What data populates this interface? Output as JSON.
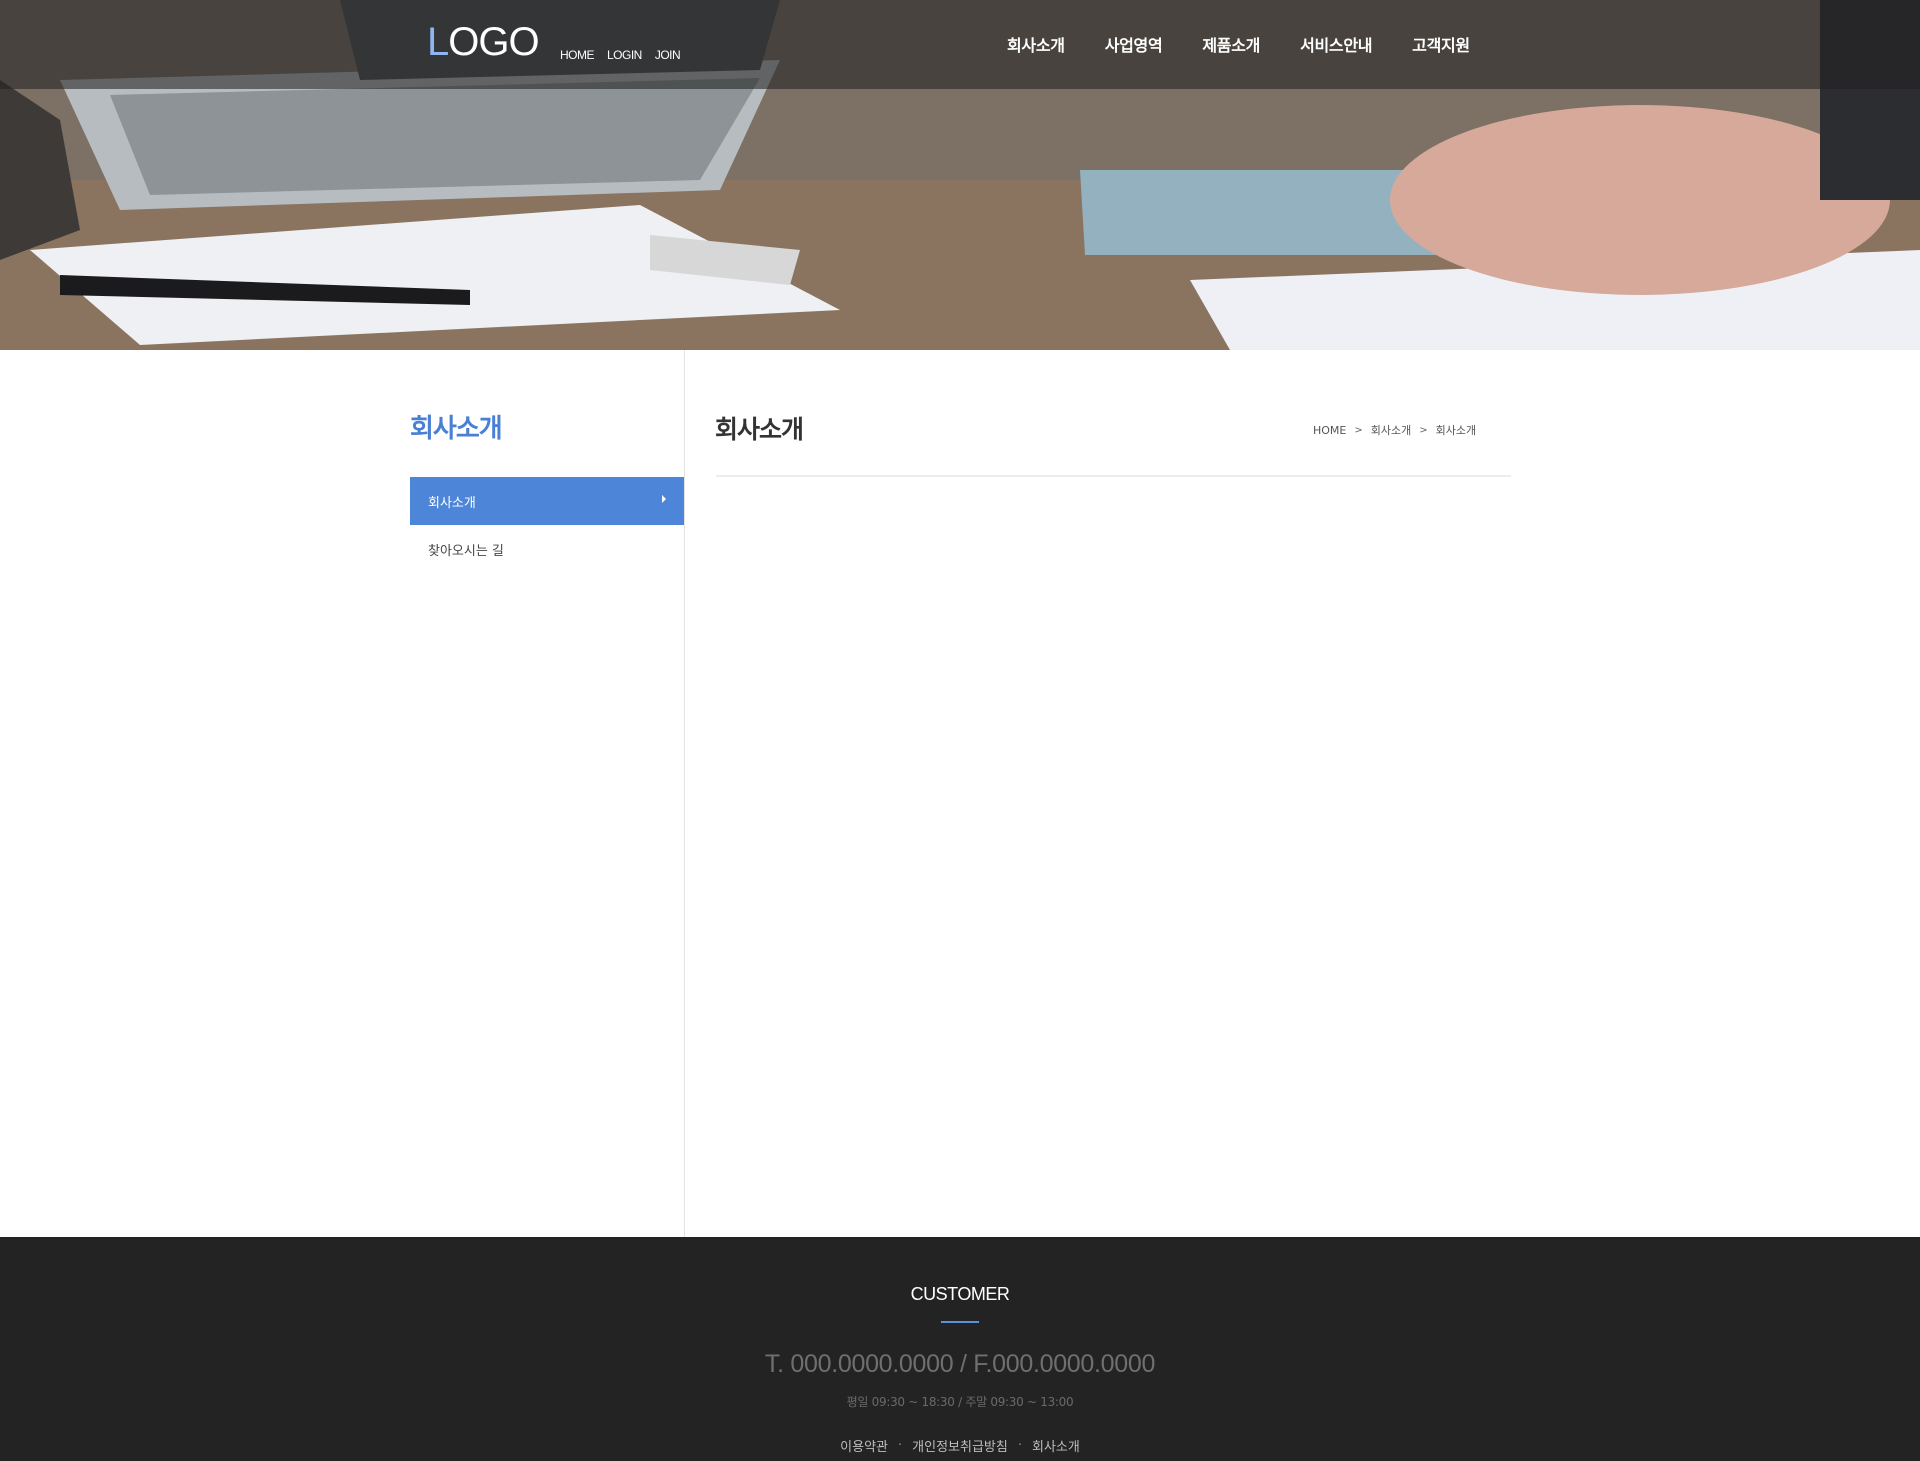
{
  "header": {
    "logo_first": "L",
    "logo_rest": "OGO",
    "util_nav": [
      "HOME",
      "LOGIN",
      "JOIN"
    ],
    "gnb": [
      "회사소개",
      "사업영역",
      "제품소개",
      "서비스안내",
      "고객지원"
    ]
  },
  "sidebar": {
    "title": "회사소개",
    "items": [
      {
        "label": "회사소개",
        "active": true
      },
      {
        "label": "찾아오시는 길",
        "active": false
      }
    ]
  },
  "main": {
    "title": "회사소개",
    "breadcrumb": [
      "HOME",
      "회사소개",
      "회사소개"
    ],
    "breadcrumb_separator": ">"
  },
  "footer": {
    "title": "CUSTOMER",
    "tel": "T. 000.0000.0000 / F.000.0000.0000",
    "hours": "평일 09:30 ~ 18:30 / 주말 09:30 ~ 13:00",
    "links": [
      "이용약관",
      "개인정보취급방침",
      "회사소개"
    ],
    "link_separator": "·"
  },
  "colors": {
    "accent": "#4d86d8",
    "sidebar_title": "#4a7fd6",
    "logo_accent": "#8fb4f2",
    "footer_bg": "#232323"
  }
}
